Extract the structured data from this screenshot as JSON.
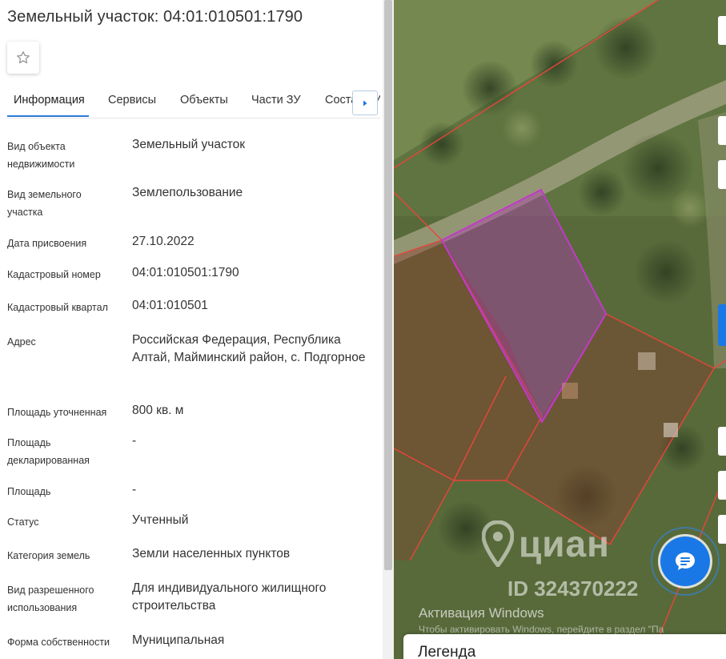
{
  "title": "Земельный участок: 04:01:010501:1790",
  "favorite_icon": "star-outline-icon",
  "tabs": [
    {
      "label": "Информация",
      "active": true
    },
    {
      "label": "Сервисы"
    },
    {
      "label": "Объекты"
    },
    {
      "label": "Части ЗУ"
    },
    {
      "label": "Состав ЗУ"
    }
  ],
  "tabs_next_icon": "chevron-right-icon",
  "fields": [
    {
      "label": "Вид объекта недвижимости",
      "value": "Земельный участок"
    },
    {
      "label": "Вид земельного участка",
      "value": "Землепользование"
    },
    {
      "label": "Дата присвоения",
      "value": "27.10.2022"
    },
    {
      "label": "Кадастровый номер",
      "value": "04:01:010501:1790"
    },
    {
      "label": "Кадастровый квартал",
      "value": "04:01:010501"
    },
    {
      "label": "Адрес",
      "value": "Российская Федерация, Республика Алтай, Майминский район, с. Подгорное"
    },
    {
      "label": "Площадь уточненная",
      "value": "800 кв. м"
    },
    {
      "label": "Площадь декларированная",
      "value": "-"
    },
    {
      "label": "Площадь",
      "value": "-"
    },
    {
      "label": "Статус",
      "value": "Учтенный"
    },
    {
      "label": "Категория земель",
      "value": "Земли населенных пунктов"
    },
    {
      "label": "Вид разрешенного использования",
      "value": "Для индивидуального жилищного строительства"
    },
    {
      "label": "Форма собственности",
      "value": "Муниципальная"
    }
  ],
  "map": {
    "watermark_logo": "циан",
    "watermark_id": "ID 324370222",
    "windows_activation_title": "Активация Windows",
    "windows_activation_hint": "Чтобы активировать Windows, перейдите в раздел \"Па",
    "chat_icon": "chat-bubble-icon",
    "legend_label": "Легенда",
    "colors": {
      "selected_parcel": "#b03ab8",
      "parcel_border": "#e8453c",
      "chat_button": "#1a78e6"
    }
  }
}
